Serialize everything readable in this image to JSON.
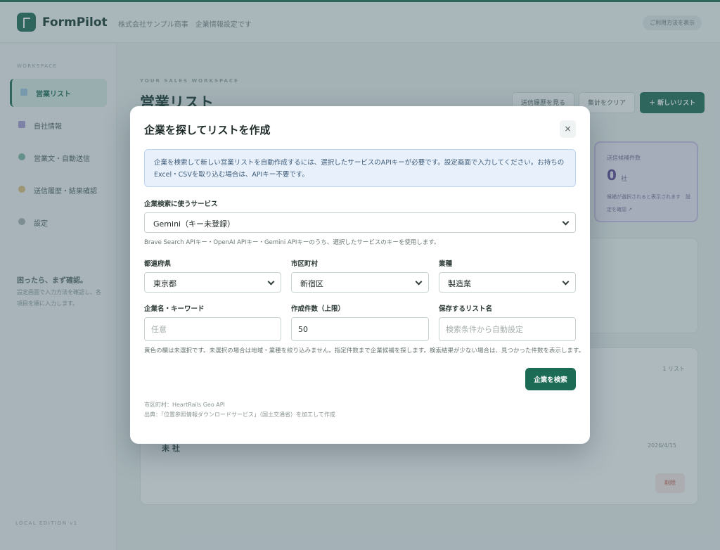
{
  "header": {
    "app_name": "FormPilot",
    "company_text": "株式会社サンプル商事　企業情報設定です",
    "chip": "ご利用方法を表示"
  },
  "sidebar": {
    "section": "WORKSPACE",
    "items": [
      {
        "label": "営業リスト",
        "icon": "list-icon"
      },
      {
        "label": "自社情報",
        "icon": "building-icon"
      },
      {
        "label": "営業文・自動送信",
        "icon": "send-icon"
      },
      {
        "label": "送信履歴・結果確認",
        "icon": "history-icon"
      },
      {
        "label": "設定",
        "icon": "gear-icon"
      }
    ],
    "tip_title": "困ったら、まず確認。",
    "tip_body": "設定画面で入力方法を確認し、各項目を順に入力します。",
    "version": "LOCAL EDITION v1"
  },
  "main": {
    "eyebrow": "YOUR SALES WORKSPACE",
    "title": "営業リスト",
    "buttons": {
      "history": "送信履歴を見る",
      "template": "集計をクリア",
      "new_list": "＋ 新しいリスト"
    },
    "stat": {
      "label": "送信候補件数",
      "value": "0",
      "unit": "社",
      "note": "候補が選択されると表示されます　設定を確認 ↗"
    },
    "panel": {
      "count": "1 リスト",
      "row_name": "未 社",
      "row_date": "2026/4/15",
      "delete_label": "削除"
    }
  },
  "modal": {
    "title": "企業を探してリストを作成",
    "close_symbol": "×",
    "info": "企業を検索して新しい営業リストを自動作成するには、選択したサービスのAPIキーが必要です。設定画面で入力してください。お持ちのExcel・CSVを取り込む場合は、APIキー不要です。",
    "service": {
      "label": "企業検索に使うサービス",
      "value": "Gemini（キー未登録）",
      "help": "Brave Search APIキー・OpenAI APIキー・Gemini APIキーのうち、選択したサービスのキーを使用します。"
    },
    "prefecture": {
      "label": "都道府県",
      "value": "東京都"
    },
    "city": {
      "label": "市区町村",
      "value": "新宿区"
    },
    "industry": {
      "label": "業種",
      "value": "製造業"
    },
    "keyword": {
      "label": "企業名・キーワード",
      "placeholder": "任意",
      "value": ""
    },
    "limit": {
      "label": "作成件数（上限）",
      "value": "50"
    },
    "list_name": {
      "label": "保存するリスト名",
      "placeholder": "検索条件から自動設定",
      "value": ""
    },
    "note": "黄色の欄は未選択です。未選択の場合は地域・業種を絞り込みません。指定件数まで企業候補を探します。検索結果が少ない場合は、見つかった件数を表示します。",
    "search_button": "企業を検索",
    "credit_1": "市区町村：HeartRails Geo API",
    "credit_2": "出典：「位置参照情報ダウンロードサービス」（国土交通省）を加工して作成"
  }
}
